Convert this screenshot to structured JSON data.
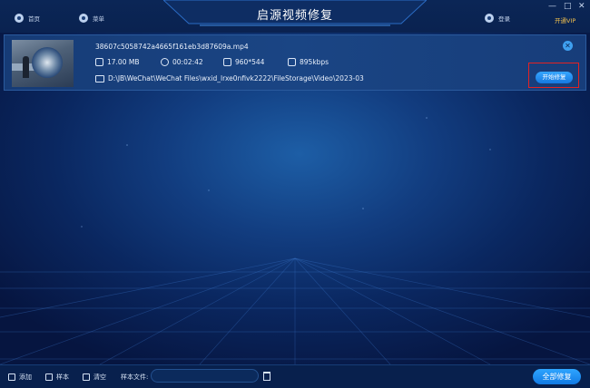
{
  "app": {
    "title": "启源视频修复",
    "vip_label": "开通VIP",
    "window_controls": {
      "minimize": "—",
      "maximize": "□",
      "close": "✕"
    }
  },
  "nav": {
    "home_label": "首页",
    "menu_label": "菜单",
    "login_label": "登录"
  },
  "file": {
    "name": "38607c5058742a4665f161eb3d87609a.mp4",
    "size": "17.00 MB",
    "duration": "00:02:42",
    "resolution": "960*544",
    "bitrate": "895kbps",
    "path": "D:\\JB\\WeChat\\WeChat Files\\wxid_lrxe0nfivk2222\\FileStorage\\Video\\2023-03",
    "start_repair_label": "开始修复"
  },
  "bottom": {
    "add_label": "添加",
    "sample_label": "样本",
    "clear_label": "清空",
    "sample_file_label": "样本文件:",
    "sample_file_value": "",
    "repair_all_label": "全部修复"
  },
  "colors": {
    "accent": "#1e8ef5",
    "highlight_box": "#e32222",
    "vip": "#f2c14e"
  }
}
